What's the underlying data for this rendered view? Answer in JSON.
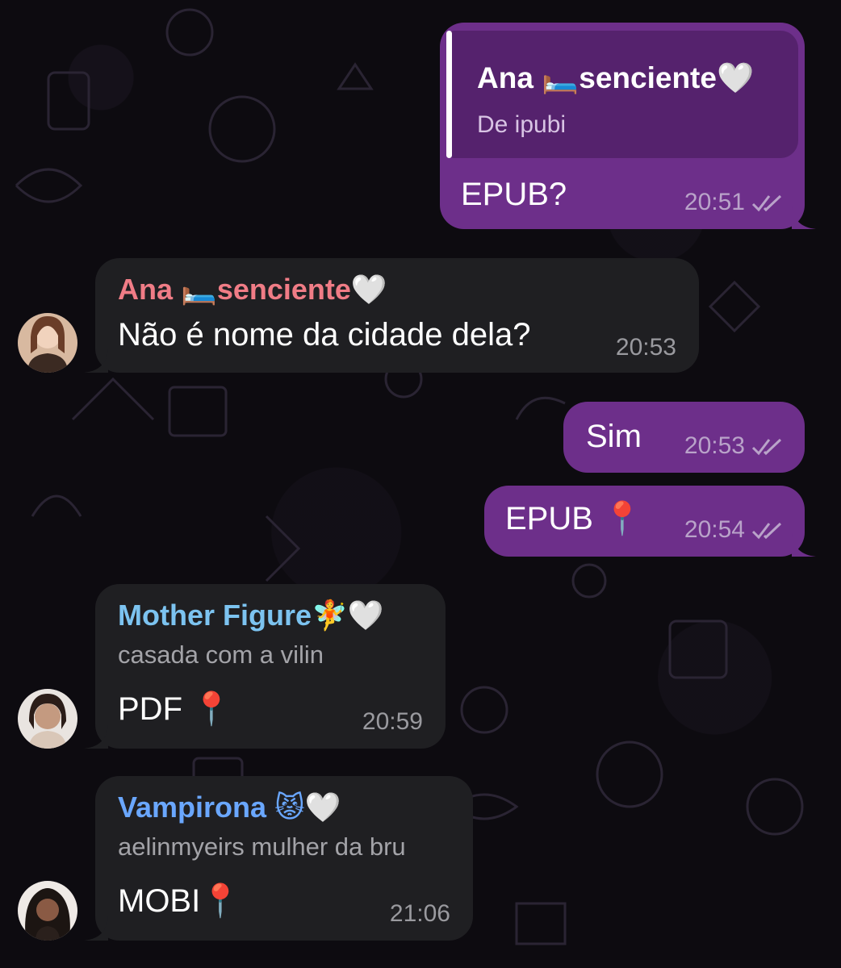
{
  "colors": {
    "outgoing_bubble": "#6d2f8a",
    "incoming_bubble": "#1f1f22",
    "reply_block": "#55226d",
    "sender_ana": "#f07c86",
    "sender_mother": "#7cc3f0",
    "sender_vampirona": "#6aa7ff",
    "background": "#0d0b10"
  },
  "messages": [
    {
      "direction": "outgoing",
      "reply": {
        "name": "Ana 🛏️senciente🤍",
        "subtitle": "De ipubi"
      },
      "text": "EPUB?",
      "time": "20:51",
      "status_icon": "double-check-icon"
    },
    {
      "direction": "incoming",
      "sender": "Ana 🛏️senciente🤍",
      "text": "Não é nome da cidade dela?",
      "time": "20:53",
      "avatar_icon": "user-avatar-ana"
    },
    {
      "direction": "outgoing",
      "text": "Sim",
      "time": "20:53",
      "status_icon": "double-check-icon"
    },
    {
      "direction": "outgoing",
      "text": "EPUB 📍",
      "time": "20:54",
      "status_icon": "double-check-icon"
    },
    {
      "direction": "incoming",
      "sender": "Mother Figure🧚🤍",
      "subtitle": "casada com a vilin",
      "text": "PDF 📍",
      "time": "20:59",
      "avatar_icon": "user-avatar-mother-figure"
    },
    {
      "direction": "incoming",
      "sender": "Vampirona 😾🤍",
      "subtitle": "aelinmyeirs mulher da bru",
      "text": "MOBI📍",
      "time": "21:06",
      "avatar_icon": "user-avatar-vampirona"
    }
  ]
}
